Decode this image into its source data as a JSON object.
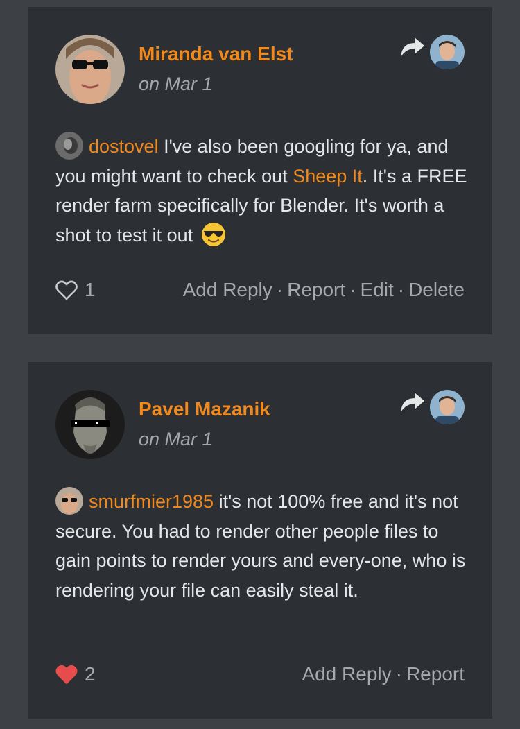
{
  "comments": [
    {
      "author": "Miranda van Elst",
      "date": "on Mar 1",
      "mention": "dostovel",
      "text_before_link": "I've also been googling for ya, and you might want to check out",
      "link": "Sheep It",
      "text_after_link": ". It's a FREE render farm specifically for Blender. It's worth a shot to test it out",
      "emoji": "sunglasses-emoji",
      "likes": "1",
      "liked": false,
      "actions": [
        "Add Reply",
        "Report",
        "Edit",
        "Delete"
      ]
    },
    {
      "author": "Pavel Mazanik",
      "date": "on Mar 1",
      "mention": "smurfmier1985",
      "text": "it's not 100% free and it's not secure. You had to render other people files to gain points to render yours and every-one, who is rendering your file can easily steal it.",
      "likes": "2",
      "liked": true,
      "actions": [
        "Add Reply",
        "Report"
      ]
    }
  ],
  "colors": {
    "accent": "#f0891e",
    "card": "#2c2f33",
    "background": "#3d4145",
    "muted": "#a5a9ad",
    "like_active": "#e74c4c"
  },
  "icons": {
    "share": "share-arrow-icon",
    "like_empty": "heart-outline-icon",
    "like_filled": "heart-filled-icon"
  }
}
